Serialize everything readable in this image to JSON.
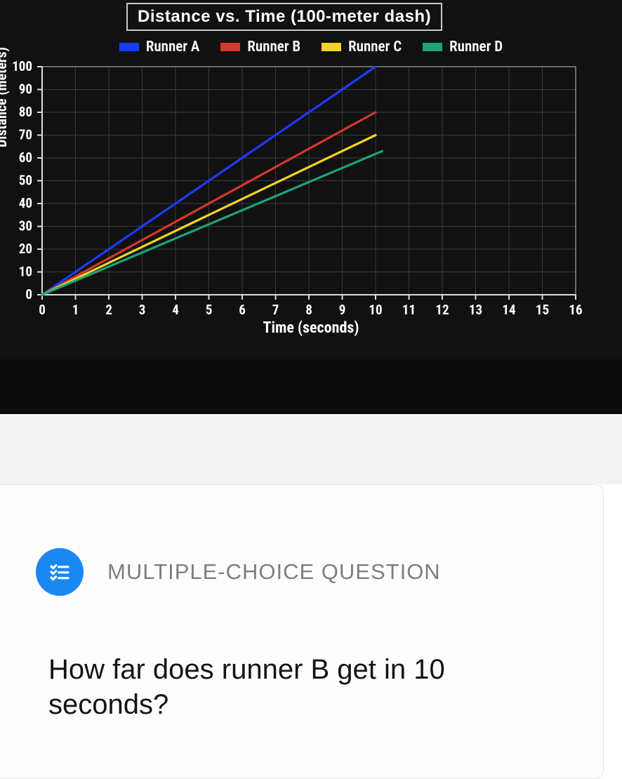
{
  "chart_data": {
    "type": "line",
    "title": "Distance vs. Time (100-meter dash)",
    "xlabel": "Time (seconds)",
    "ylabel": "Distance (meters)",
    "xlim": [
      0,
      16
    ],
    "ylim": [
      0,
      100
    ],
    "x_ticks": [
      0,
      1,
      2,
      3,
      4,
      5,
      6,
      7,
      8,
      9,
      10,
      11,
      12,
      13,
      14,
      15,
      16
    ],
    "y_ticks": [
      0,
      10,
      20,
      30,
      40,
      50,
      60,
      70,
      80,
      90,
      100
    ],
    "grid": true,
    "legend_position": "top",
    "series": [
      {
        "name": "Runner A",
        "color": "#1a3cff",
        "x": [
          0,
          10
        ],
        "y": [
          0,
          100
        ]
      },
      {
        "name": "Runner B",
        "color": "#d6362d",
        "x": [
          0,
          10
        ],
        "y": [
          0,
          80
        ]
      },
      {
        "name": "Runner C",
        "color": "#f2d426",
        "x": [
          0,
          10
        ],
        "y": [
          0,
          70
        ]
      },
      {
        "name": "Runner D",
        "color": "#1aa672",
        "x": [
          0,
          10.2
        ],
        "y": [
          0,
          63
        ]
      }
    ]
  },
  "legend": {
    "a": "Runner A",
    "b": "Runner B",
    "c": "Runner C",
    "d": "Runner D"
  },
  "quiz": {
    "type_label": "MULTIPLE-CHOICE QUESTION",
    "question": "How far does runner B get in 10 seconds?"
  }
}
